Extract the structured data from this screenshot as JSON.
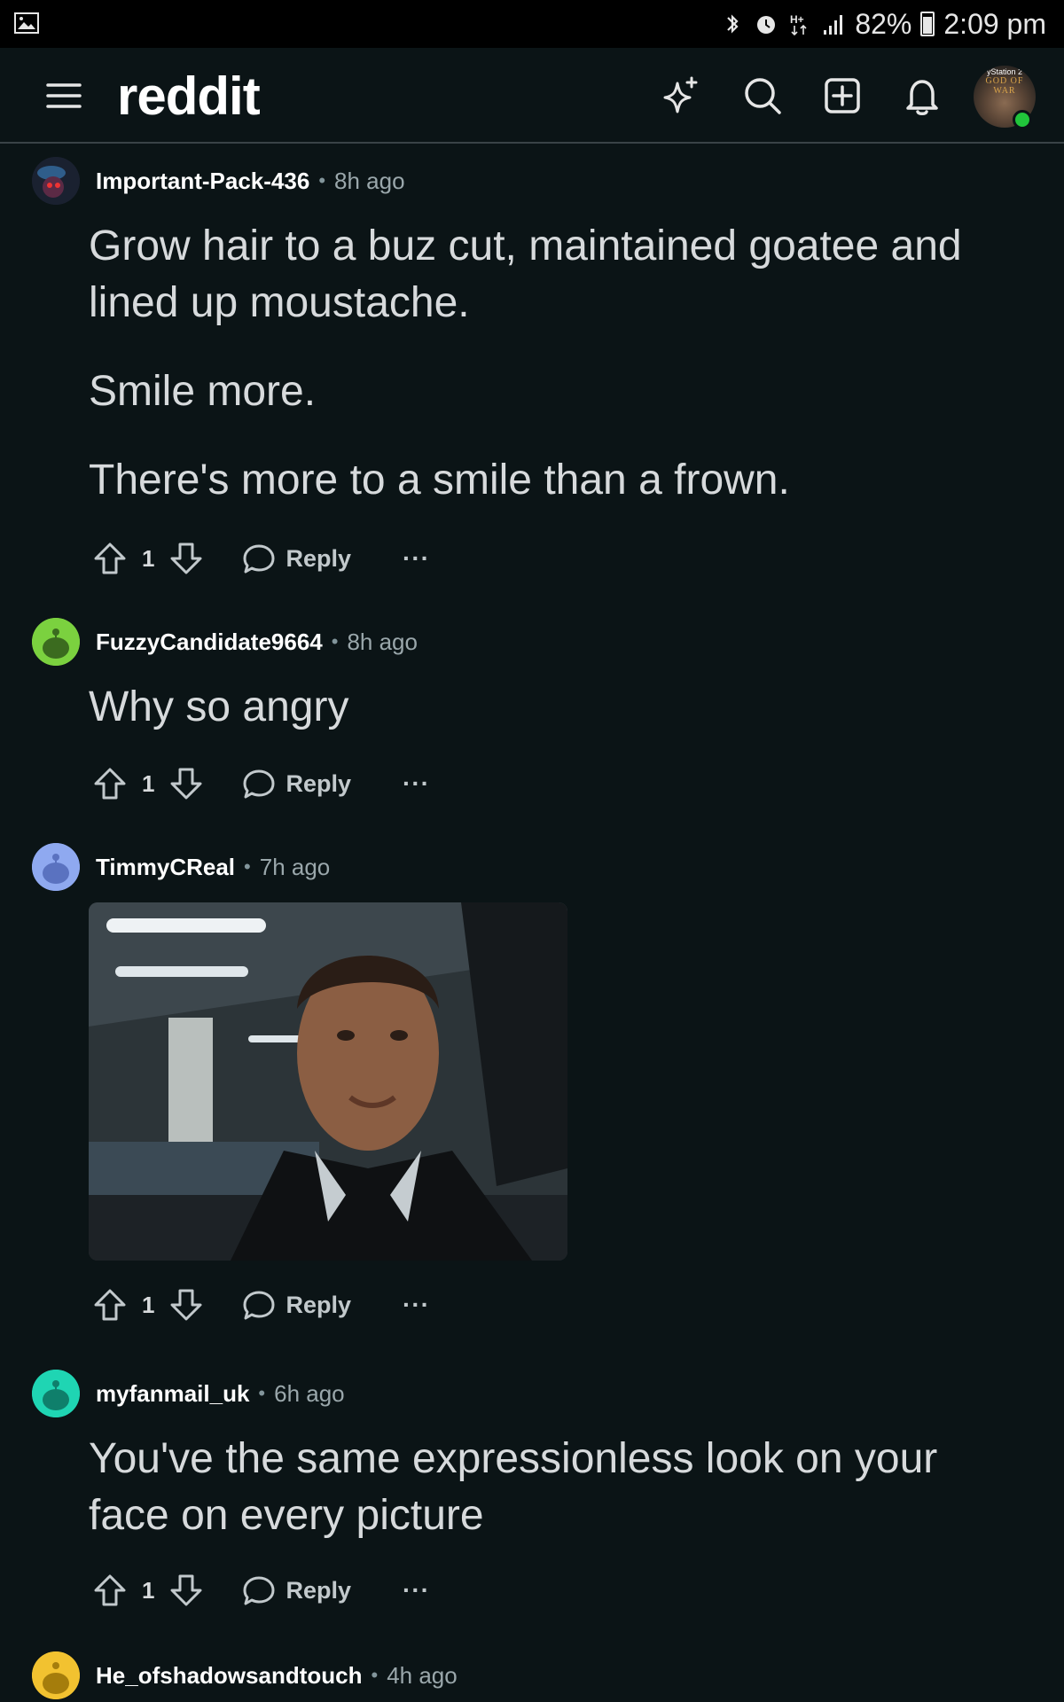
{
  "status_bar": {
    "battery": "82%",
    "time": "2:09 pm"
  },
  "header": {
    "logo": "reddit",
    "avatar_text_top": "yStation 2",
    "avatar_text": "GOD OF WAR"
  },
  "comments": [
    {
      "user": "Important-Pack-436",
      "time": "8h ago",
      "paragraphs": [
        "Grow hair to a buz cut, maintained goatee and lined up moustache.",
        "Smile more.",
        "There's more to a smile than a frown."
      ],
      "score": "1",
      "reply_label": "Reply",
      "avatar_color": "#2a3a5a"
    },
    {
      "user": "FuzzyCandidate9664",
      "time": "8h ago",
      "paragraphs": [
        "Why so angry"
      ],
      "score": "1",
      "reply_label": "Reply",
      "avatar_color": "#7bd13f"
    },
    {
      "user": "TimmyCReal",
      "time": "7h ago",
      "paragraphs": [],
      "score": "1",
      "reply_label": "Reply",
      "avatar_color": "#8fa9f0"
    },
    {
      "user": "myfanmail_uk",
      "time": "6h ago",
      "paragraphs": [
        "You've the same expressionless look on your face on every picture"
      ],
      "score": "1",
      "reply_label": "Reply",
      "avatar_color": "#1fd5b3"
    },
    {
      "user": "He_ofshadowsandtouch",
      "time": "4h ago",
      "avatar_color": "#f2c230"
    }
  ],
  "more_label": "···"
}
